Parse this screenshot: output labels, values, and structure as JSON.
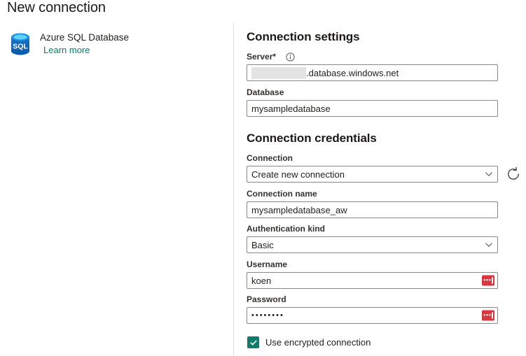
{
  "page": {
    "title": "New connection"
  },
  "connector": {
    "icon": "azure-sql-database-icon",
    "name": "Azure SQL Database",
    "learn_more_label": "Learn more",
    "link_color": "#0f7b6c"
  },
  "connection_settings": {
    "heading": "Connection settings",
    "server": {
      "label": "Server",
      "required_marker": "*",
      "info_icon": "info-icon",
      "value_redacted": true,
      "value_suffix": ".database.windows.net"
    },
    "database": {
      "label": "Database",
      "value": "mysampledatabase"
    }
  },
  "connection_credentials": {
    "heading": "Connection credentials",
    "connection": {
      "label": "Connection",
      "value": "Create new connection",
      "caret_icon": "chevron-down-icon"
    },
    "refresh": {
      "icon": "refresh-icon"
    },
    "connection_name": {
      "label": "Connection name",
      "value": "mysampledatabase_aw"
    },
    "authentication_kind": {
      "label": "Authentication kind",
      "value": "Basic",
      "caret_icon": "chevron-down-icon"
    },
    "username": {
      "label": "Username",
      "value": "koen",
      "badge_icon": "password-manager-icon",
      "badge_color": "#d9363e"
    },
    "password": {
      "label": "Password",
      "value": "••••••••",
      "badge_icon": "password-manager-icon",
      "badge_color": "#d9363e"
    },
    "use_encrypted_connection": {
      "label": "Use encrypted connection",
      "checked": true,
      "accent_color": "#0f7b6c"
    }
  }
}
